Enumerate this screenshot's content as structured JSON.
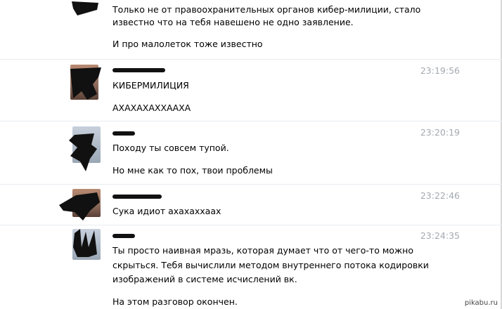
{
  "messages": [
    {
      "time": "",
      "lines": [
        "Только не от правоохранительных органов кибер-милиции, стало",
        "известно что на тебя навешено не одно заявление.",
        "И про малолеток тоже известно"
      ]
    },
    {
      "time": "23:19:56",
      "lines": [
        "КИБЕРМИЛИЦИЯ",
        "АХАХАХАХХААХА"
      ]
    },
    {
      "time": "23:20:19",
      "lines": [
        "Походу ты совсем тупой.",
        "Но мне как то пох, твои проблемы"
      ]
    },
    {
      "time": "23:22:46",
      "lines": [
        "Сука идиот ахахаххаах"
      ]
    },
    {
      "time": "23:24:35",
      "lines": [
        "Ты просто наивная мразь, которая думает что от чего-то можно",
        "скрыться. Тебя вычислили методом внутреннего потока кодировки",
        "изображений в системе исчислений вк.",
        "На этом разговор окончен."
      ]
    }
  ],
  "watermark": "pikabu.ru",
  "colors": {
    "time": "#a3a9b0",
    "divider": "#e9ecf0",
    "text": "#000000"
  }
}
